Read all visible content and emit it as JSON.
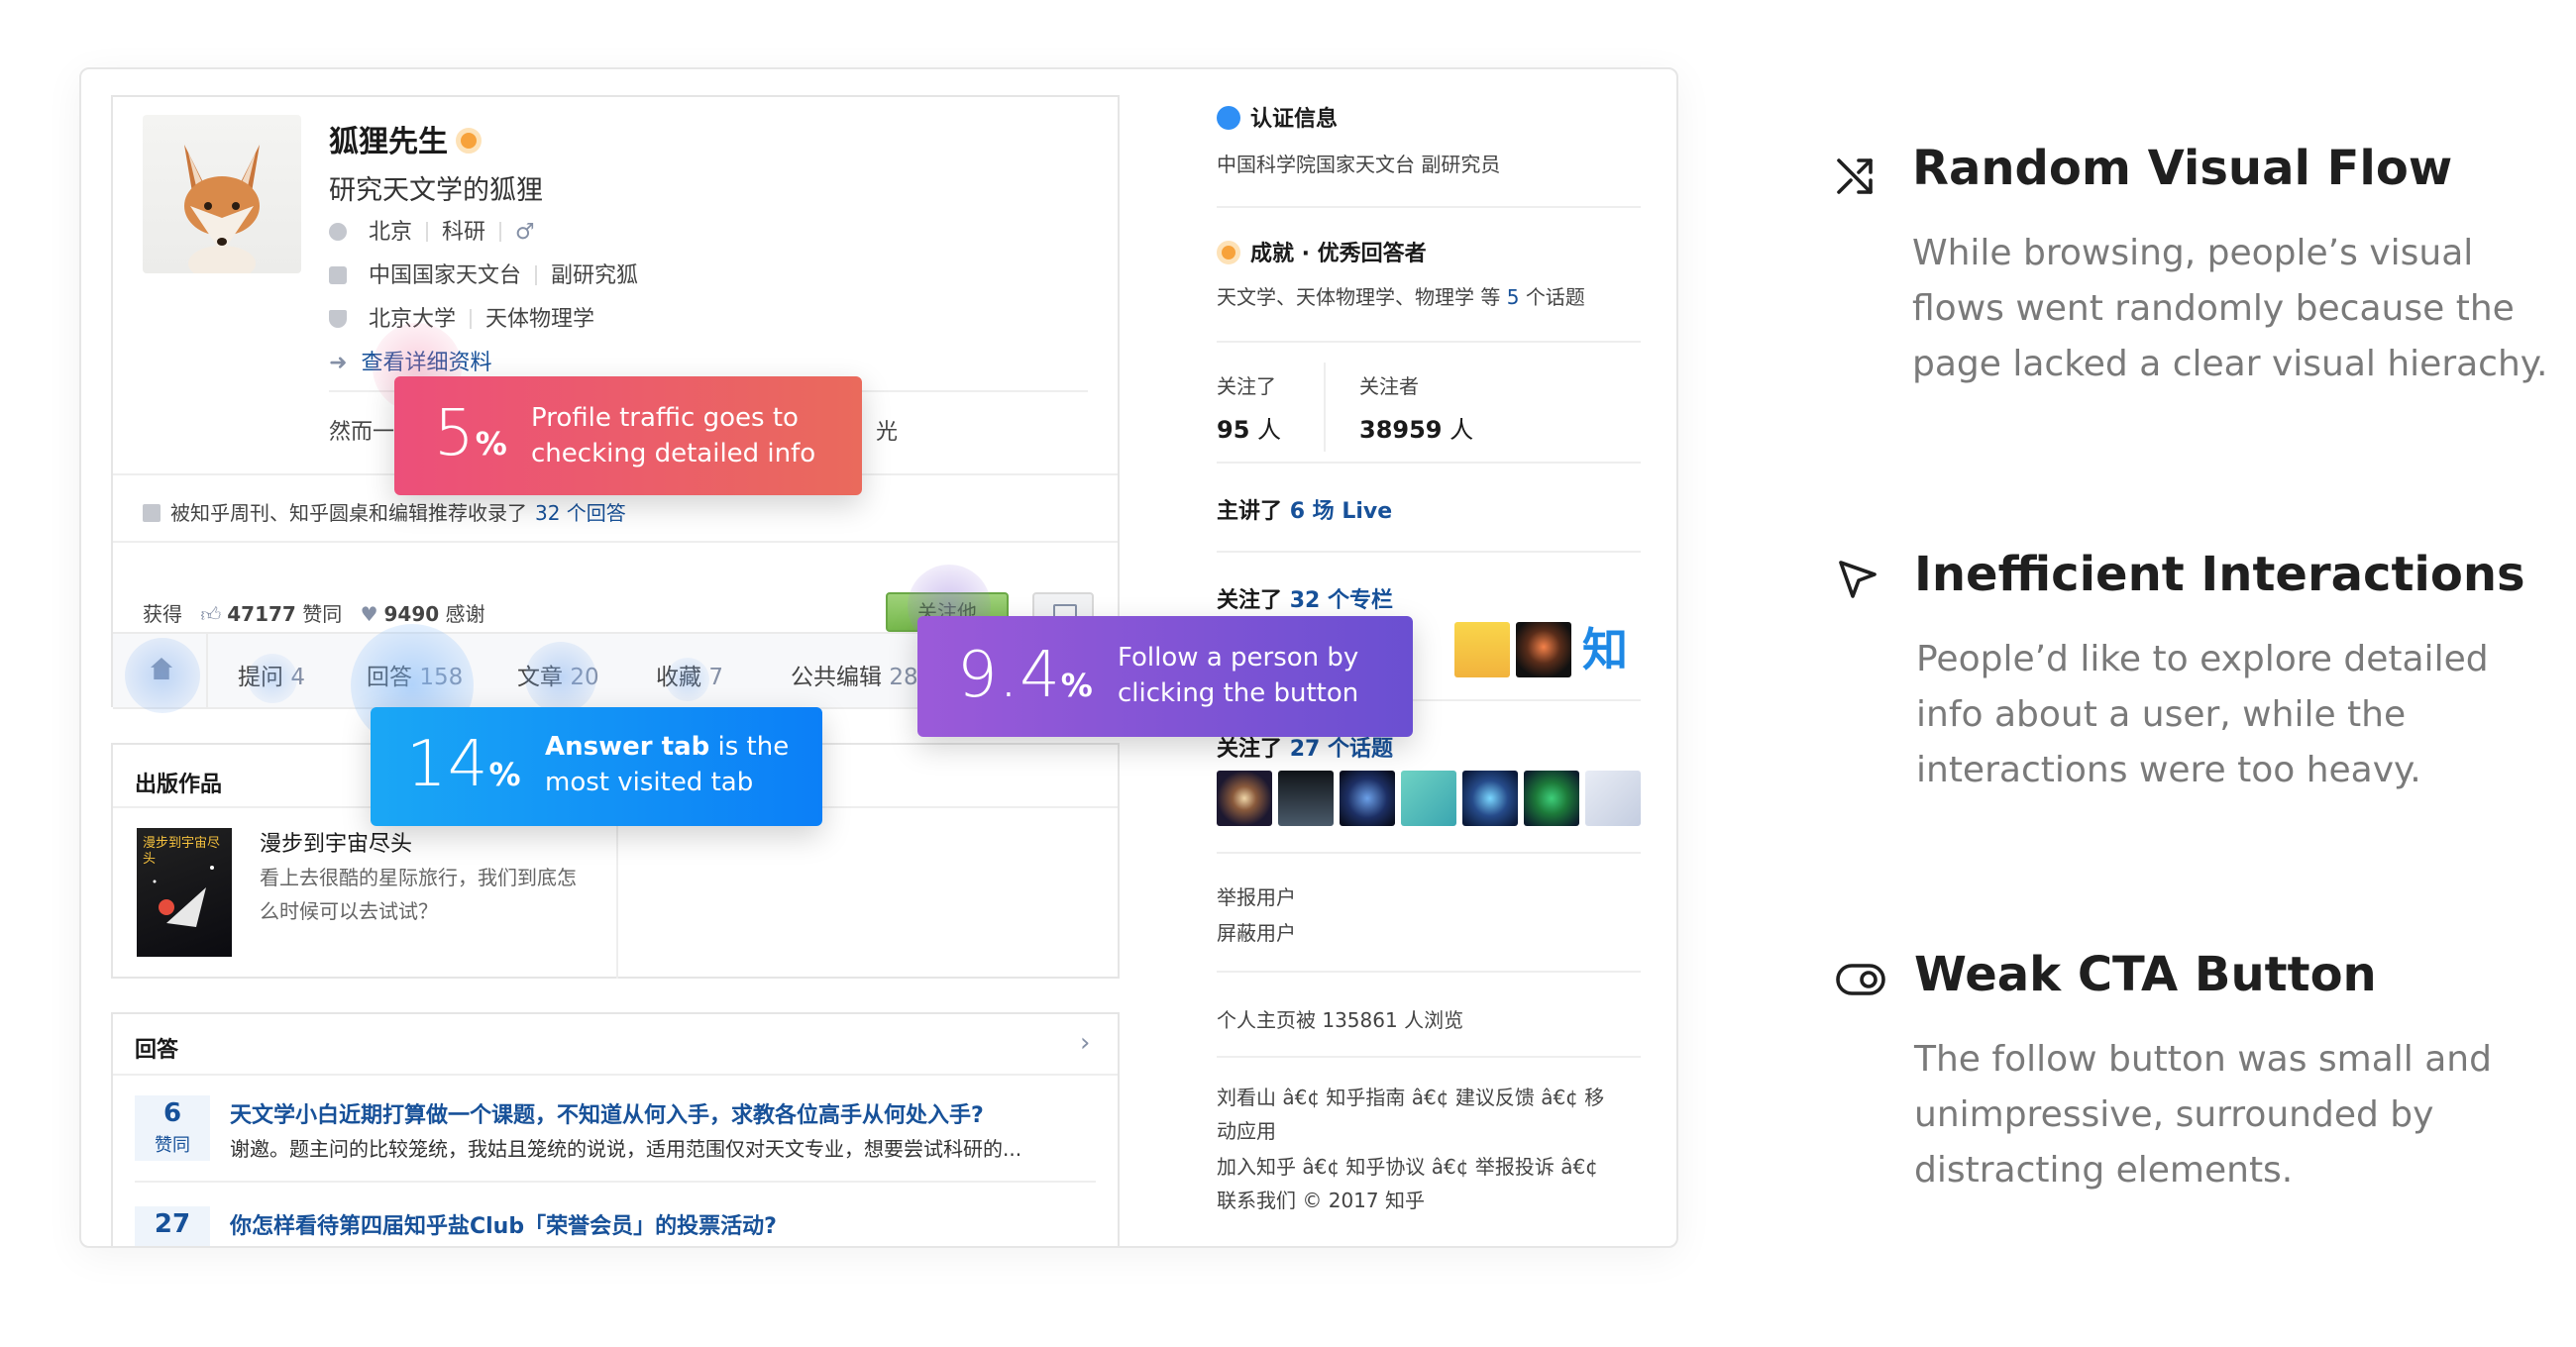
{
  "profile": {
    "name": "狐狸先生",
    "headline": "研究天文学的狐狸",
    "location": "北京",
    "industry": "科研",
    "employer": "中国国家天文台",
    "position": "副研究狐",
    "school": "北京大学",
    "major": "天体物理学",
    "detail_link": "查看详细资料",
    "bio_start": "然而一",
    "bio_end": "光",
    "recommend_text": "被知乎周刊、知乎圆桌和编辑推荐收录了",
    "recommend_link": "32 个回答",
    "earned_label": "获得",
    "likes_count": "47177",
    "likes_label": "赞同",
    "thanks_count": "9490",
    "thanks_label": "感谢",
    "follow_btn": "关注他"
  },
  "tabs": [
    {
      "label": "提问",
      "count": "4"
    },
    {
      "label": "回答",
      "count": "158"
    },
    {
      "label": "文章",
      "count": "20"
    },
    {
      "label": "收藏",
      "count": "7"
    },
    {
      "label": "公共编辑",
      "count": "284"
    }
  ],
  "publications": {
    "title": "出版作品",
    "book_cover_text": "漫步到宇宙尽头",
    "book_title": "漫步到宇宙尽头",
    "book_desc_1": "看上去很酷的星际旅行，我们到底怎",
    "book_desc_2": "么时候可以去试试？"
  },
  "answers": {
    "title": "回答",
    "items": [
      {
        "votes": "6",
        "vote_label": "赞同",
        "question": "天文学小白近期打算做一个课题，不知道从何入手，求教各位高手从何处入手?",
        "excerpt": "谢邀。题主问的比较笼统，我姑且笼统的说说，适用范围仅对天文专业，想要尝试科研的..."
      },
      {
        "votes": "27",
        "vote_label": "赞同",
        "question": "你怎样看待第四届知乎盐Club「荣誉会员」的投票活动?",
        "excerpt": ""
      }
    ]
  },
  "sidebar": {
    "cert_title": "认证信息",
    "cert_desc": "中国科学院国家天文台 副研究员",
    "achieve_title": "成就 · 优秀回答者",
    "achieve_desc_pre": "天文学、天体物理学、物理学 等",
    "achieve_count": "5",
    "achieve_desc_post": "个话题",
    "following_label": "关注了",
    "following_count": "95",
    "followers_label": "关注者",
    "followers_count": "38959",
    "person_unit": "人",
    "live_pre": "主讲了",
    "live_link": "6 场 Live",
    "columns_pre": "关注了",
    "columns_link": "32 个专栏",
    "zhi_glyph": "知",
    "topics_pre": "关注了",
    "topics_link": "27 个话题",
    "report": "举报用户",
    "block": "屏蔽用户",
    "views_pre": "个人主页被",
    "views_count": "135861",
    "views_post": "人浏览",
    "footer_1": "刘看山 â€¢ 知乎指南 â€¢ 建议反馈 â€¢ 移",
    "footer_2": "动应用",
    "footer_3": "加入知乎 â€¢ 知乎协议 â€¢ 举报投诉 â€¢",
    "footer_4": "联系我们 © 2017 知乎"
  },
  "callouts": [
    {
      "number": "5",
      "pct": "%",
      "line1": "Profile traffic goes to",
      "line2": "checking detailed info"
    },
    {
      "number": "14",
      "pct": "%",
      "line1_bold": "Answer tab",
      "line1_rest": " is the",
      "line2": "most visited tab"
    },
    {
      "number": "9.4",
      "pct": "%",
      "line1": "Follow a person by",
      "line2": "clicking the button"
    }
  ],
  "insights": [
    {
      "icon": "shuffle-icon",
      "title": "Random Visual Flow",
      "lines": [
        "While browsing,  people’s visual",
        "flows went randomly because the",
        "page lacked a clear visual hierachy."
      ]
    },
    {
      "icon": "cursor-icon",
      "title": "Inefficient Interactions",
      "lines": [
        "People’d like to explore detailed",
        "info about a user, while the",
        "interactions were too heavy."
      ]
    },
    {
      "icon": "toggle-icon",
      "title": "Weak CTA Button",
      "lines": [
        "The follow button was small and",
        "unimpressive, surrounded by",
        "distracting elements."
      ]
    }
  ],
  "colors": {
    "callout_red_start": "#ec4f7a",
    "callout_red_end": "#ea6a5c",
    "callout_blue_start": "#1aa7f5",
    "callout_blue_end": "#0b7ff7",
    "callout_purple_start": "#9b5ad9",
    "callout_purple_end": "#6a4fd1",
    "follow_green": "#76b84c",
    "link_blue": "#175199"
  }
}
